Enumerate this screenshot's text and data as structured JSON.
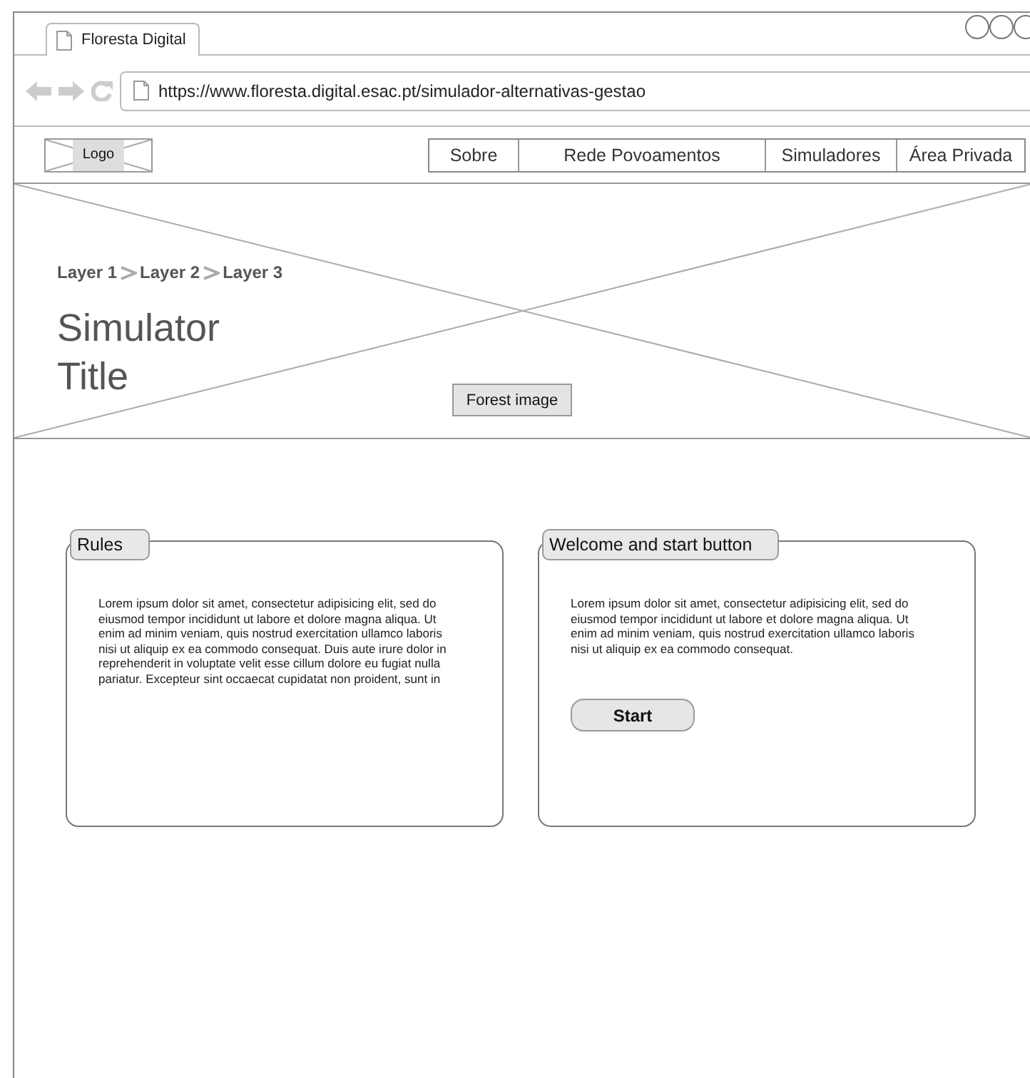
{
  "browser": {
    "tab_title": "Floresta Digital",
    "url": "https://www.floresta.digital.esac.pt/simulador-alternativas-gestao"
  },
  "header": {
    "logo": "Logo",
    "nav": [
      "Sobre",
      "Rede Povoamentos",
      "Simuladores",
      "Área Privada"
    ]
  },
  "hero": {
    "breadcrumb": [
      "Layer 1",
      "Layer 2",
      "Layer 3"
    ],
    "title": "Simulator Title",
    "image_label": "Forest image"
  },
  "panels": [
    {
      "title": "Rules",
      "text": "Lorem ipsum dolor sit amet, consectetur adipisicing elit, sed do eiusmod tempor incididunt ut labore et dolore magna aliqua. Ut enim ad minim veniam, quis nostrud exercitation ullamco laboris nisi ut aliquip ex ea commodo consequat. Duis aute irure dolor in reprehenderit in voluptate velit esse cillum dolore eu fugiat nulla pariatur. Excepteur sint occaecat cupidatat non proident, sunt in"
    },
    {
      "title": "Welcome and start button",
      "text": "Lorem ipsum dolor sit amet, consectetur adipisicing elit, sed do eiusmod tempor incididunt ut labore et dolore magna aliqua. Ut enim ad minim veniam, quis nostrud exercitation ullamco laboris nisi ut aliquip ex ea commodo consequat.",
      "button": "Start"
    }
  ]
}
